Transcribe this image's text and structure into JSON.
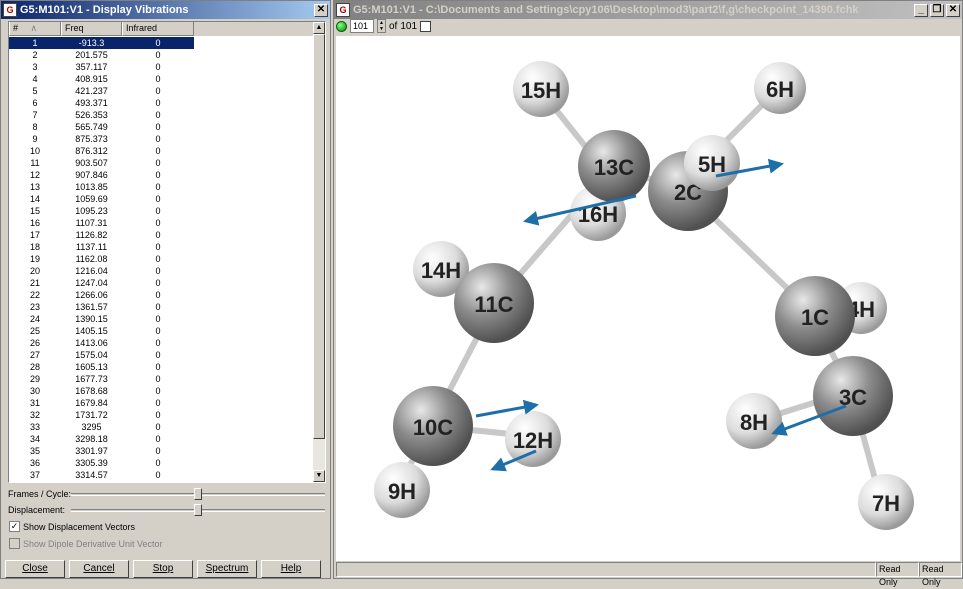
{
  "left_window": {
    "title": "G5:M101:V1 - Display Vibrations",
    "columns": [
      "#",
      "Freq",
      "Infrared"
    ],
    "rows": [
      [
        "1",
        "-913.3",
        "0"
      ],
      [
        "2",
        "201.575",
        "0"
      ],
      [
        "3",
        "357.117",
        "0"
      ],
      [
        "4",
        "408.915",
        "0"
      ],
      [
        "5",
        "421.237",
        "0"
      ],
      [
        "6",
        "493.371",
        "0"
      ],
      [
        "7",
        "526.353",
        "0"
      ],
      [
        "8",
        "565.749",
        "0"
      ],
      [
        "9",
        "875.373",
        "0"
      ],
      [
        "10",
        "876.312",
        "0"
      ],
      [
        "11",
        "903.507",
        "0"
      ],
      [
        "12",
        "907.846",
        "0"
      ],
      [
        "13",
        "1013.85",
        "0"
      ],
      [
        "14",
        "1059.69",
        "0"
      ],
      [
        "15",
        "1095.23",
        "0"
      ],
      [
        "16",
        "1107.31",
        "0"
      ],
      [
        "17",
        "1126.82",
        "0"
      ],
      [
        "18",
        "1137.11",
        "0"
      ],
      [
        "19",
        "1162.08",
        "0"
      ],
      [
        "20",
        "1216.04",
        "0"
      ],
      [
        "21",
        "1247.04",
        "0"
      ],
      [
        "22",
        "1266.06",
        "0"
      ],
      [
        "23",
        "1361.57",
        "0"
      ],
      [
        "24",
        "1390.15",
        "0"
      ],
      [
        "25",
        "1405.15",
        "0"
      ],
      [
        "26",
        "1413.06",
        "0"
      ],
      [
        "27",
        "1575.04",
        "0"
      ],
      [
        "28",
        "1605.13",
        "0"
      ],
      [
        "29",
        "1677.73",
        "0"
      ],
      [
        "30",
        "1678.68",
        "0"
      ],
      [
        "31",
        "1679.84",
        "0"
      ],
      [
        "32",
        "1731.72",
        "0"
      ],
      [
        "33",
        "3295",
        "0"
      ],
      [
        "34",
        "3298.18",
        "0"
      ],
      [
        "35",
        "3301.97",
        "0"
      ],
      [
        "36",
        "3305.39",
        "0"
      ],
      [
        "37",
        "3314.57",
        "0"
      ]
    ],
    "selected_row": "1",
    "frames_label": "Frames / Cycle:",
    "frames_value": 0.5,
    "displacement_label": "Displacement:",
    "displacement_value": 0.5,
    "show_displacement_label": "Show Displacement Vectors",
    "show_displacement_checked": "✓",
    "show_dipole_label": "Show Dipole Derivative Unit Vector",
    "buttons": {
      "close": "Close",
      "cancel": "Cancel",
      "stop": "Stop",
      "spectrum": "Spectrum",
      "help": "Help"
    }
  },
  "right_window": {
    "title": "G5:M101:V1 - C:\\Documents and Settings\\cpy106\\Desktop\\mod3\\part2\\f,g\\checkpoint_14390.fchk",
    "frame_value": "101",
    "of_label": "of",
    "frame_total": "101",
    "status": [
      "Read Only",
      "Read Only"
    ],
    "atoms": [
      {
        "label": "15H"
      },
      {
        "label": "6H"
      },
      {
        "label": "13C"
      },
      {
        "label": "5H"
      },
      {
        "label": "2C"
      },
      {
        "label": "16H"
      },
      {
        "label": "14H"
      },
      {
        "label": "11C"
      },
      {
        "label": "1C"
      },
      {
        "label": "4H"
      },
      {
        "label": "3C"
      },
      {
        "label": "8H"
      },
      {
        "label": "10C"
      },
      {
        "label": "12H"
      },
      {
        "label": "9H"
      },
      {
        "label": "7H"
      }
    ]
  }
}
